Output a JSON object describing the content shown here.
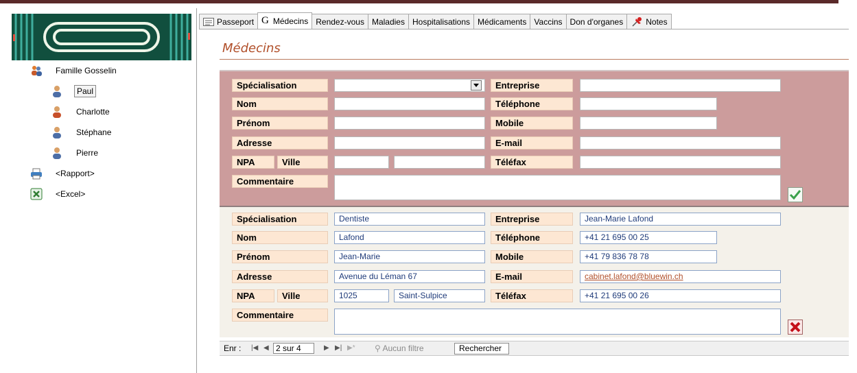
{
  "sidebar": {
    "family": "Famille Gosselin",
    "members": [
      "Paul",
      "Charlotte",
      "Stéphane",
      "Pierre"
    ],
    "selected": "Paul",
    "report": "<Rapport>",
    "excel": "<Excel>"
  },
  "tabs": [
    {
      "label": "Passeport",
      "icon": "form-icon"
    },
    {
      "label": "Médecins",
      "icon": "g-letter-icon",
      "prefix": "G"
    },
    {
      "label": "Rendez-vous"
    },
    {
      "label": "Maladies"
    },
    {
      "label": "Hospitalisations"
    },
    {
      "label": "Médicaments"
    },
    {
      "label": "Vaccins"
    },
    {
      "label": "Don d'organes"
    },
    {
      "label": "Notes",
      "icon": "pushpin-icon"
    }
  ],
  "page_title": "Médecins",
  "labels": {
    "specialisation": "Spécialisation",
    "nom": "Nom",
    "prenom": "Prénom",
    "adresse": "Adresse",
    "npa": "NPA",
    "ville": "Ville",
    "commentaire": "Commentaire",
    "entreprise": "Entreprise",
    "telephone": "Téléphone",
    "mobile": "Mobile",
    "email": "E-mail",
    "telefax": "Téléfax"
  },
  "record": {
    "specialisation": "Dentiste",
    "nom": "Lafond",
    "prenom": "Jean-Marie",
    "adresse": "Avenue du Léman 67",
    "npa": "1025",
    "ville": "Saint-Sulpice",
    "commentaire": "",
    "entreprise": "Jean-Marie Lafond",
    "telephone": "+41 21 695 00 25",
    "mobile": "+41 79 836 78 78",
    "email": "cabinet.lafond@bluewin.ch",
    "telefax": "+41 21 695 00 26"
  },
  "navbar": {
    "label": "Enr :",
    "position": "2 sur 4",
    "filter": "Aucun filtre",
    "search": "Rechercher"
  },
  "colors": {
    "edit_panel": "#cc9c9c",
    "record_panel": "#f4f1ea",
    "label_bg": "#fde7d3",
    "title": "#b1502b",
    "save": "#3aa14a",
    "delete": "#c4101a"
  }
}
